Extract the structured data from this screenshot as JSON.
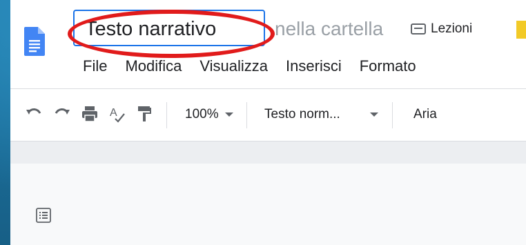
{
  "document": {
    "title": "Testo narrativo",
    "folder_prefix": "nella cartella",
    "folder_name": "Lezioni"
  },
  "menu": {
    "items": [
      "File",
      "Modifica",
      "Visualizza",
      "Inserisci",
      "Formato"
    ]
  },
  "toolbar": {
    "zoom": "100%",
    "style": "Testo norm...",
    "font": "Aria"
  },
  "icons": {
    "logo": "google-docs-icon",
    "folder": "folder-icon",
    "undo": "undo-icon",
    "redo": "redo-icon",
    "print": "print-icon",
    "spellcheck": "spellcheck-icon",
    "paint_format": "paint-format-icon",
    "outline": "document-outline-icon"
  },
  "colors": {
    "frame": "#1d6c96",
    "docs_blue": "#4285f4",
    "highlight_ellipse": "#e11b1b",
    "title_focus": "#1a73e8"
  }
}
